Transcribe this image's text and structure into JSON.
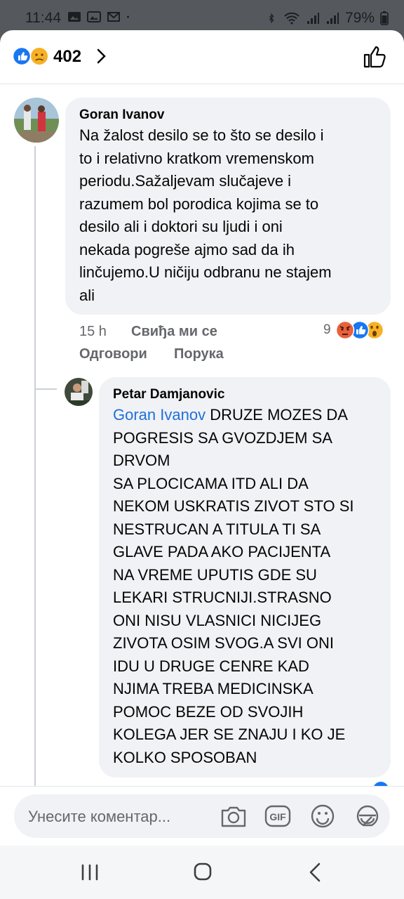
{
  "status_bar": {
    "time": "11:44",
    "battery": "79%",
    "icons": [
      "gallery-icon",
      "image-icon",
      "gmail-icon",
      "dot-icon",
      "bluetooth-icon",
      "wifi-icon",
      "signal-icon",
      "signal-icon",
      "battery-icon"
    ]
  },
  "reactions_header": {
    "count": "402",
    "icons": [
      "like-reaction-icon",
      "sad-reaction-icon",
      "chevron-right-icon",
      "thumbs-up-outline-icon"
    ]
  },
  "comments": [
    {
      "author": "Goran Ivanov",
      "text": "Na žalost desilo se to što se desilo i\nto i relativno kratkom vremenskom\nperiodu.Sažaljevam slučajeve i\nrazumem bol porodica kojima se to\ndesilo ali i doktori su ljudi i oni\nnekada pogreše ajmo sad da ih\nlinčujemo.U ničiju odbranu ne stajem\nali",
      "time": "15 h",
      "like_label": "Свиђа ми се",
      "reply_label": "Одговори",
      "message_label": "Порука",
      "reaction_count": "9",
      "reaction_icons": [
        "angry-reaction-icon",
        "like-reaction-icon",
        "wow-reaction-icon"
      ]
    },
    {
      "author": "Petar Damjanovic",
      "mention": "Goran Ivanov",
      "text_first_line": " DRUZE MOZES DA",
      "text": "POGRESIS SA GVOZDJEM SA\nDRVOM\nSA PLOCICAMA ITD ALI DA\nNEKOM USKRATIS ZIVOT STO SI\nNESTRUCAN A TITULA TI SA\nGLAVE PADA AKO PACIJENTA\nNA VREME UPUTIS GDE SU\nLEKARI STRUCNIJI.STRASNO\nONI NISU VLASNICI NICIJEG\nZIVOTA OSIM SVOG.A SVI ONI\nIDU U DRUGE CENRE KAD\nNJIMA TREBA MEDICINSKA\nPOMOC BEZE OD SVOJIH\nKOLEGA JER SE ZNAJU I KO JE\nKOLKO SPOSOBAN"
    }
  ],
  "composer": {
    "placeholder": "Унесите коментар...",
    "icons": [
      "camera-icon",
      "gif-icon",
      "emoji-icon",
      "sticker-icon"
    ]
  },
  "nav_bar": {
    "icons": [
      "recents-icon",
      "home-icon",
      "back-icon"
    ]
  },
  "colors": {
    "accent": "#1877f2",
    "mention": "#216fdb",
    "bubble": "#f0f2f5",
    "secondary_text": "#65676b"
  }
}
